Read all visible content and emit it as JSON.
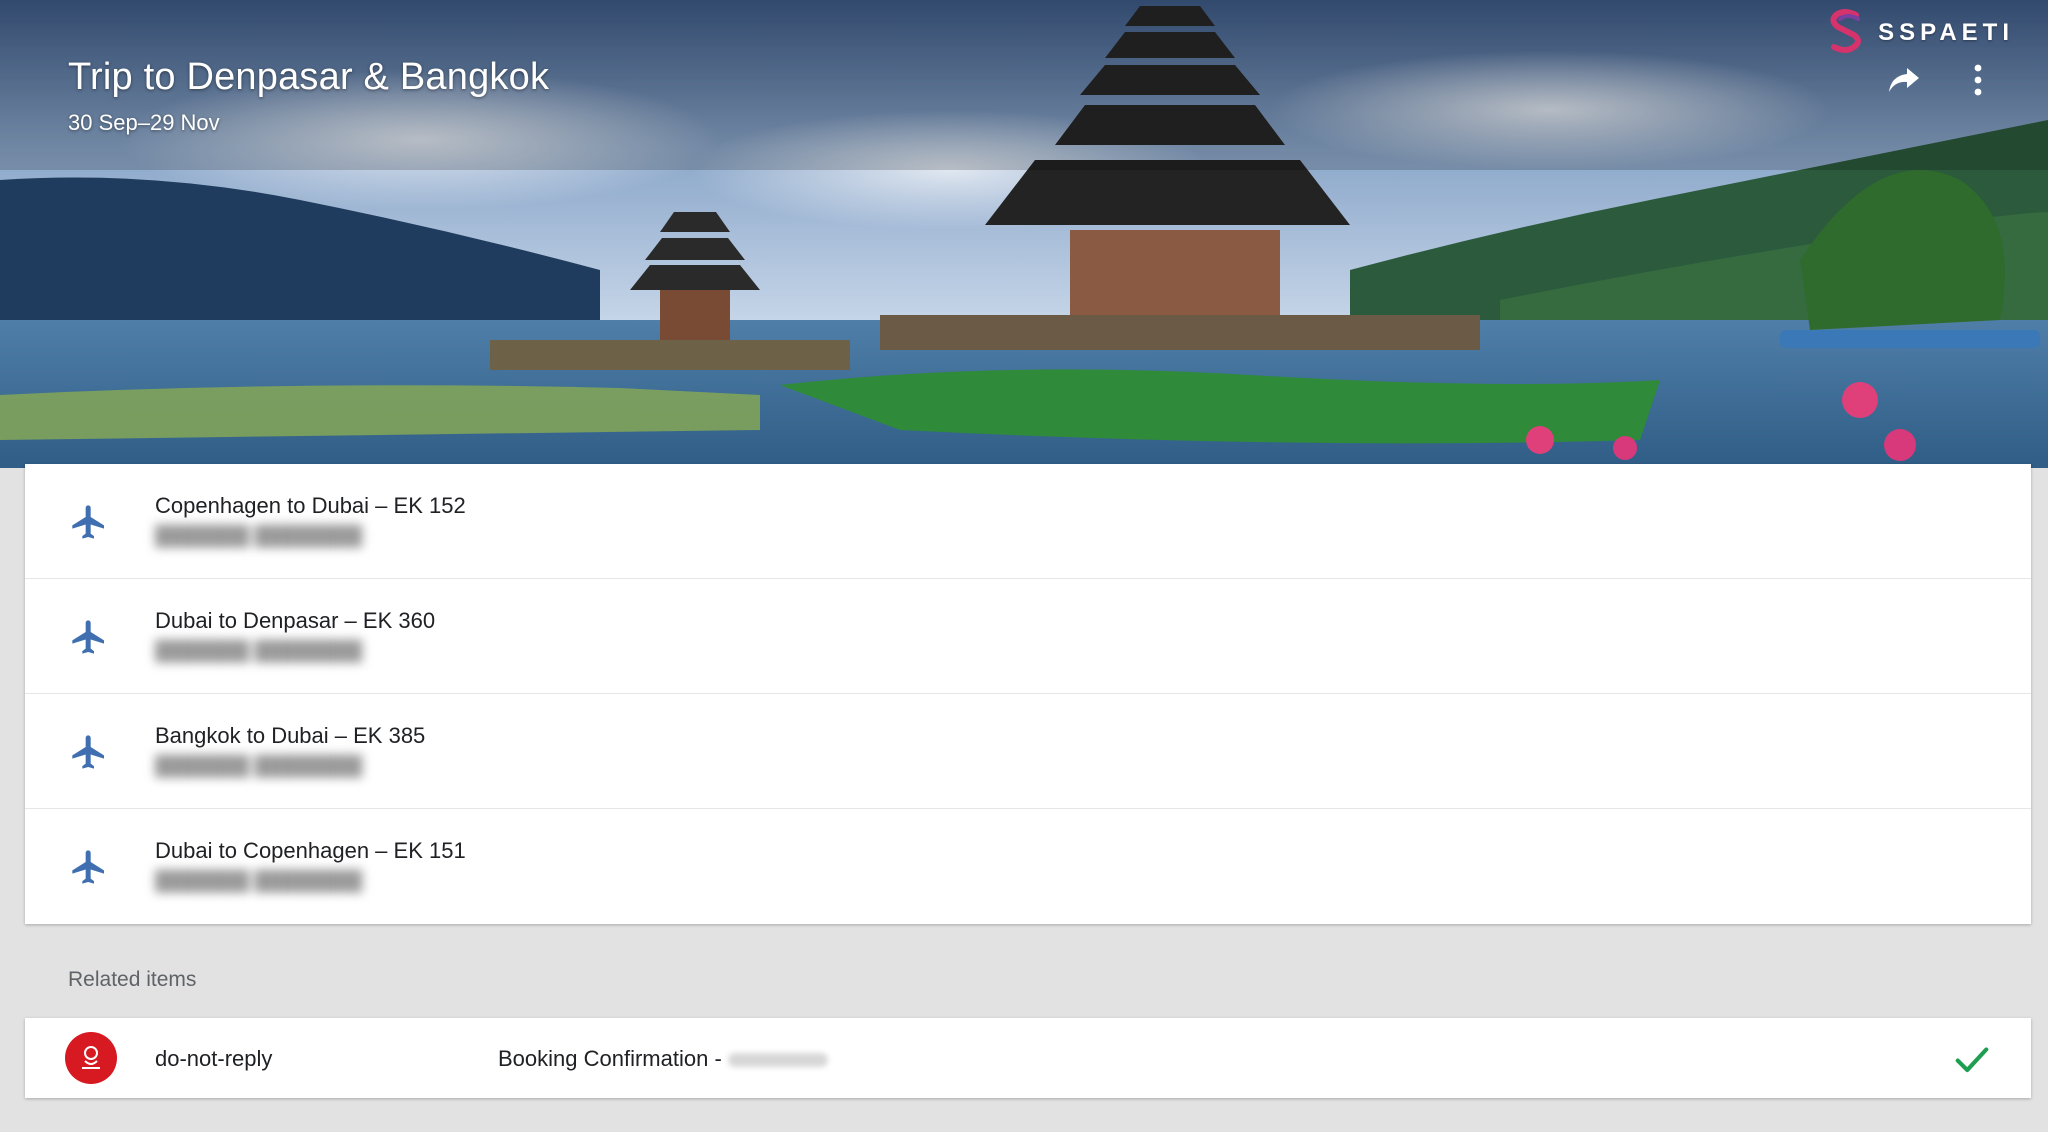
{
  "trip": {
    "title": "Trip to Denpasar & Bangkok",
    "dates": "30 Sep–29 Nov"
  },
  "brand": {
    "name": "SSPAETI",
    "logo_icon": "brand-s-logo-icon"
  },
  "header_actions": {
    "share_icon": "share-arrow-icon",
    "more_icon": "more-vert-icon"
  },
  "flights": [
    {
      "title": "Copenhagen to Dubai – EK 152",
      "icon": "airplane-icon"
    },
    {
      "title": "Dubai to Denpasar – EK 360",
      "icon": "airplane-icon"
    },
    {
      "title": "Bangkok to Dubai – EK 385",
      "icon": "airplane-icon"
    },
    {
      "title": "Dubai to Copenhagen – EK 151",
      "icon": "airplane-icon"
    }
  ],
  "related": {
    "label": "Related items",
    "items": [
      {
        "sender": "do-not-reply",
        "subject": "Booking Confirmation -",
        "status_icon": "checkmark-icon"
      }
    ]
  },
  "colors": {
    "accent_blue": "#3f6fb0",
    "check_green": "#1e9e50",
    "emirates_red": "#d71921",
    "brand_pink": "#d6336c",
    "background": "#e2e2e2"
  }
}
